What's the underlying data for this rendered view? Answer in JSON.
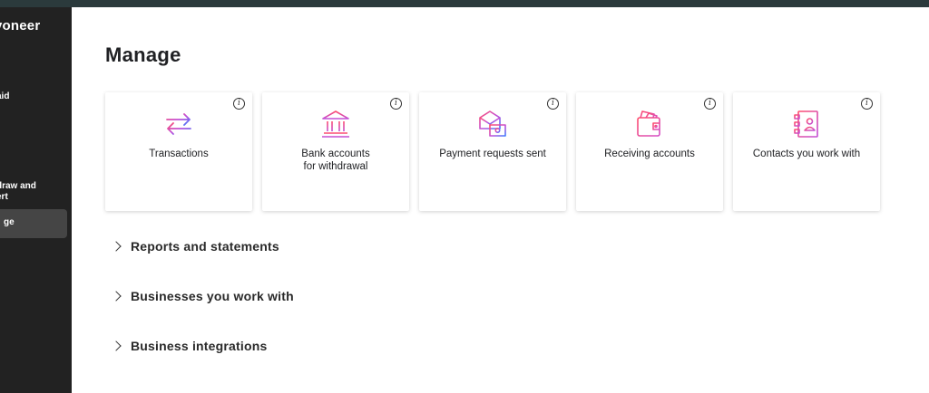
{
  "app": {
    "brand": "yoneer"
  },
  "sidebar": {
    "items": [
      {
        "label": ""
      },
      {
        "label": "aid"
      },
      {
        "label": "draw and"
      },
      {
        "label": "ert"
      },
      {
        "label": "ge"
      }
    ]
  },
  "main": {
    "title": "Manage",
    "cards": [
      {
        "label_line1": "Transactions",
        "label_line2": "",
        "icon": "transfer-arrows-icon"
      },
      {
        "label_line1": "Bank accounts",
        "label_line2": "for withdrawal",
        "icon": "bank-icon"
      },
      {
        "label_line1": "Payment requests sent",
        "label_line2": "",
        "icon": "payment-request-icon"
      },
      {
        "label_line1": "Receiving accounts",
        "label_line2": "",
        "icon": "wallet-icon"
      },
      {
        "label_line1": "Contacts you work with",
        "label_line2": "",
        "icon": "address-book-icon"
      }
    ],
    "info_symbol": "i",
    "sections": [
      {
        "label": "Reports and statements"
      },
      {
        "label": "Businesses you work with"
      },
      {
        "label": "Business integrations"
      }
    ]
  },
  "colors": {
    "sidebar_bg": "#222222",
    "topbar_bg": "#2b3a3c",
    "icon_gradient_start": "#ff4d6d",
    "icon_gradient_mid": "#c24fd8",
    "icon_gradient_end": "#3d7bff"
  }
}
